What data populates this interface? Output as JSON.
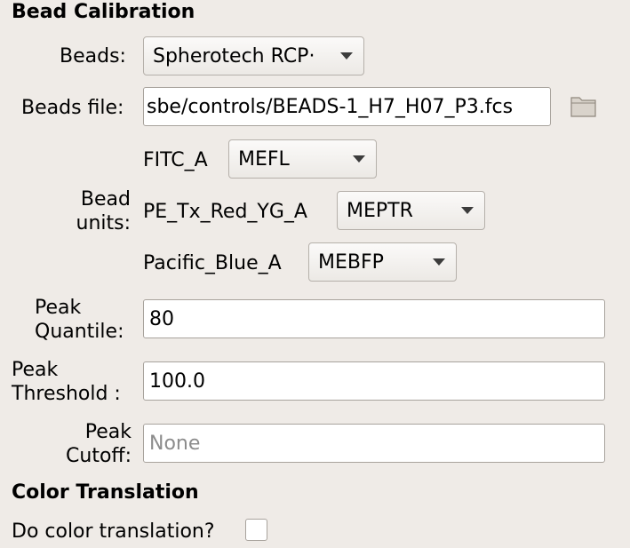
{
  "bead_calibration": {
    "title": "Bead Calibration",
    "beads_label": "Beads:",
    "beads_value": "Spherotech RCP·",
    "beads_file_label": "Beads file:",
    "beads_file_value": "sbe/controls/BEADS-1_H7_H07_P3.fcs",
    "folder_icon": "folder-icon",
    "bead_units_label_line1": "Bead",
    "bead_units_label_line2": "units:",
    "channels": [
      {
        "name": "FITC_A",
        "unit": "MEFL"
      },
      {
        "name": "PE_Tx_Red_YG_A",
        "unit": "MEPTR"
      },
      {
        "name": "Pacific_Blue_A",
        "unit": "MEBFP"
      }
    ],
    "peak_quantile_label_line1": "Peak",
    "peak_quantile_label_line2": "Quantile:",
    "peak_quantile_value": "80",
    "peak_threshold_label_line1": "Peak",
    "peak_threshold_label_line2": "Threshold :",
    "peak_threshold_value": "100.0",
    "peak_cutoff_label_line1": "Peak",
    "peak_cutoff_label_line2": "Cutoff:",
    "peak_cutoff_placeholder": "None"
  },
  "color_translation": {
    "title": "Color Translation",
    "do_translation_label": "Do color translation?",
    "do_translation_checked": false
  },
  "colors": {
    "background": "#efebe7",
    "field_border": "#a8a39d"
  }
}
